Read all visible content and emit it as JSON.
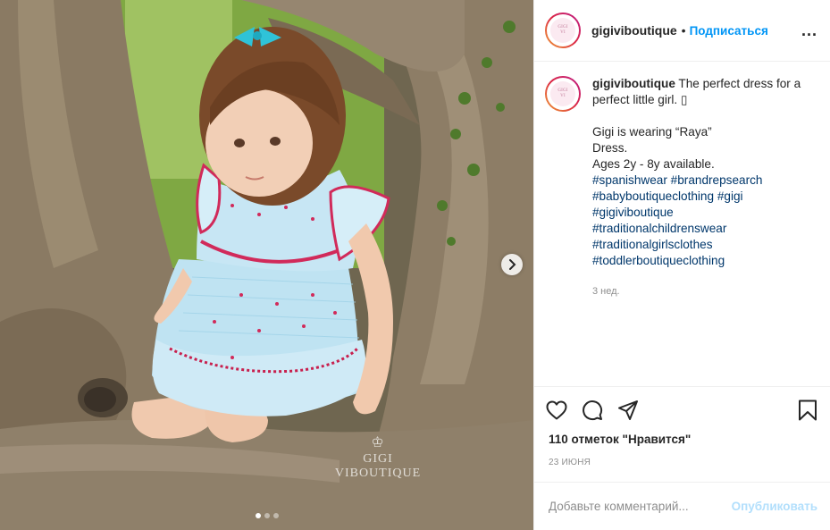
{
  "post": {
    "watermark_text": "GIGI VIBOUTIQUE",
    "carousel": {
      "slides": 3,
      "active": 0
    }
  },
  "header": {
    "username": "gigiviboutique",
    "separator": "•",
    "follow_label": "Подписаться",
    "more_label": "..."
  },
  "caption": {
    "username": "gigiviboutique",
    "lines": [
      "The perfect dress for a perfect little girl. ▯",
      "",
      "Gigi is wearing “Raya”",
      "Dress.",
      "Ages 2y - 8y available."
    ],
    "hashtags": [
      "#spanishwear",
      "#brandrepsearch",
      "#babyboutiqueclothing",
      "#gigi",
      "#gigiviboutique",
      "#traditionalchildrenswear",
      "#traditionalgirlsclothes",
      "#toddlerboutiqueclothing"
    ],
    "time": "3 нед."
  },
  "actions": {
    "icons": [
      "heart-icon",
      "comment-icon",
      "share-icon",
      "bookmark-icon"
    ]
  },
  "likes_label": "110 отметок \"Нравится\"",
  "date_label": "23 июня",
  "comment_box": {
    "placeholder": "Добавьте комментарий...",
    "post_label": "Опубликовать"
  },
  "colors": {
    "follow": "#0095f6",
    "hashtag": "#00376b",
    "post_disabled": "#b2dffc",
    "story_ring": "#dc2743"
  }
}
